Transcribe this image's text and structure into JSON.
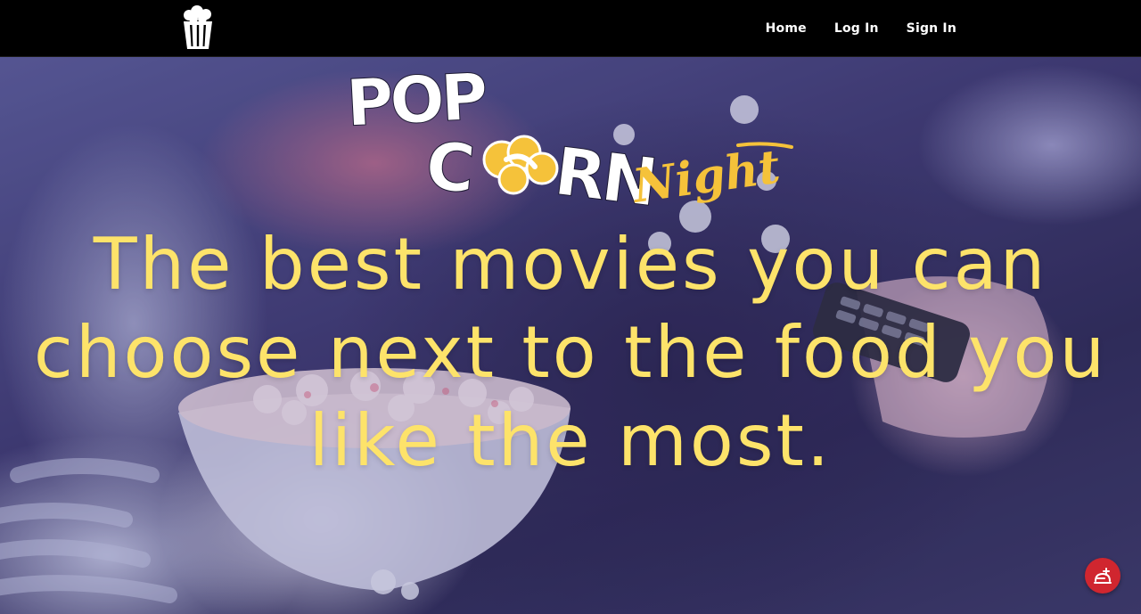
{
  "navbar": {
    "logo_icon": "popcorn-bucket-icon",
    "links": [
      {
        "label": "Home"
      },
      {
        "label": "Log In"
      },
      {
        "label": "Sign In"
      }
    ]
  },
  "hero": {
    "brand": {
      "word1": "POP",
      "word2a": "C",
      "word2b": "RN",
      "script": "Night"
    },
    "headline_lines": [
      "The best movies you can",
      "choose next to the food you",
      "like the most."
    ]
  },
  "fab": {
    "icon": "food-delivery-icon"
  },
  "colors": {
    "navbar": "#000000",
    "headline": "#fde36a",
    "brand_accent": "#f5c23a",
    "fab": "#d0262f"
  }
}
